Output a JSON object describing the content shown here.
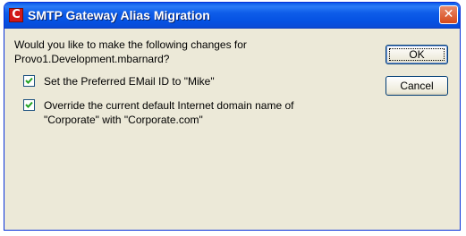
{
  "window": {
    "title": "SMTP Gateway Alias Migration",
    "app_icon_letter": "C",
    "close_glyph": "✕"
  },
  "dialog": {
    "prompt_line1": "Would you like to make the following changes for",
    "prompt_line2": "Provo1.Development.mbarnard?",
    "options": [
      {
        "label": "Set the Preferred EMail ID to \"Mike\"",
        "checked": true
      },
      {
        "label_line1": "Override the current default Internet domain name of",
        "label_line2": "\"Corporate\" with \"Corporate.com\"",
        "checked": true
      }
    ],
    "buttons": {
      "ok": "OK",
      "cancel": "Cancel"
    }
  },
  "colors": {
    "titlebar": "#0551e2",
    "client": "#ece9d8",
    "close": "#d6491a",
    "checkbox_border": "#1c5180",
    "checkmark": "#21a121"
  },
  "icons": [
    "app-icon",
    "close-icon",
    "checkmark-icon"
  ]
}
